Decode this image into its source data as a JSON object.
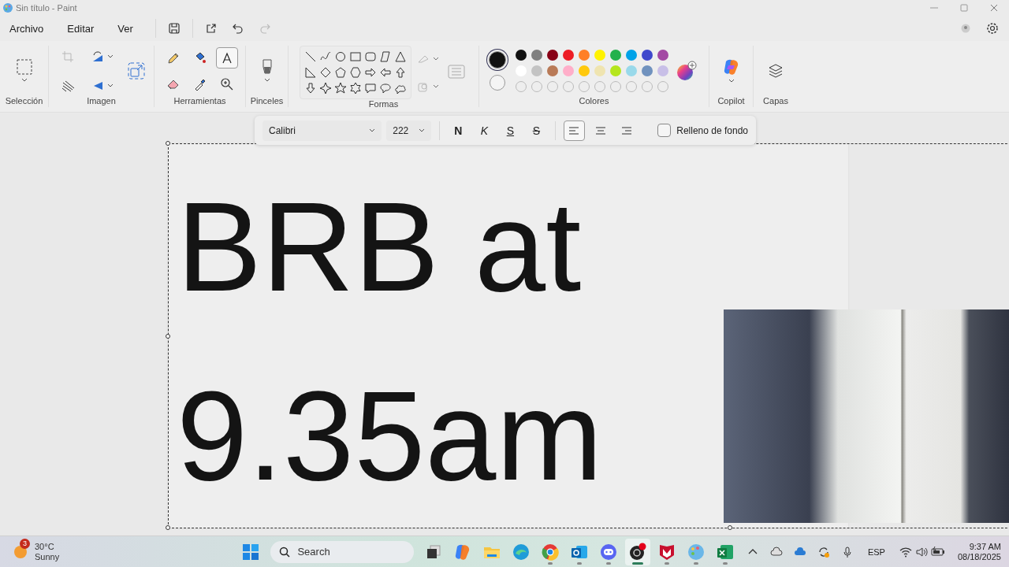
{
  "window": {
    "title": "Sin título - Paint"
  },
  "menu": [
    "Archivo",
    "Editar",
    "Ver"
  ],
  "quick_actions": [
    {
      "kind": "save",
      "disabled": false
    },
    {
      "kind": "share",
      "disabled": false
    },
    {
      "kind": "undo",
      "disabled": false
    },
    {
      "kind": "redo",
      "disabled": true
    }
  ],
  "ribbon": {
    "groups": [
      {
        "label": "Selección",
        "kind": "selection"
      },
      {
        "label": "Imagen",
        "kind": "image"
      },
      {
        "label": "Herramientas",
        "kind": "tools",
        "tools": [
          {
            "kind": "pencil",
            "selected": false
          },
          {
            "kind": "fill",
            "selected": false
          },
          {
            "kind": "text",
            "selected": true
          },
          {
            "kind": "eraser",
            "selected": false
          },
          {
            "kind": "picker",
            "selected": false
          },
          {
            "kind": "zoom",
            "selected": false
          }
        ]
      },
      {
        "label": "Pinceles",
        "kind": "brushes"
      },
      {
        "label": "Formas",
        "kind": "shapes"
      },
      {
        "label": "Colores",
        "kind": "colors",
        "current": [
          {
            "color": "#111111",
            "selected": true
          },
          {
            "color": "#f4f4f4",
            "selected": false
          }
        ],
        "palette": [
          {
            "kind": "swatch",
            "color": "#111111"
          },
          {
            "kind": "swatch",
            "color": "#7f7f7f"
          },
          {
            "kind": "swatch",
            "color": "#880015"
          },
          {
            "kind": "swatch",
            "color": "#ed1c24"
          },
          {
            "kind": "swatch",
            "color": "#ff7f27"
          },
          {
            "kind": "swatch",
            "color": "#fff200"
          },
          {
            "kind": "swatch",
            "color": "#22b14c"
          },
          {
            "kind": "swatch",
            "color": "#00a2e8"
          },
          {
            "kind": "swatch",
            "color": "#3f48cc"
          },
          {
            "kind": "swatch",
            "color": "#a349a4"
          },
          {
            "kind": "swatch",
            "color": "#ffffff"
          },
          {
            "kind": "swatch",
            "color": "#c3c3c3"
          },
          {
            "kind": "swatch",
            "color": "#b97a57"
          },
          {
            "kind": "swatch",
            "color": "#ffaec9"
          },
          {
            "kind": "swatch",
            "color": "#ffc90e"
          },
          {
            "kind": "swatch",
            "color": "#efe4b0"
          },
          {
            "kind": "swatch",
            "color": "#b5e61d"
          },
          {
            "kind": "swatch",
            "color": "#99d9ea"
          },
          {
            "kind": "swatch",
            "color": "#7092be"
          },
          {
            "kind": "swatch",
            "color": "#c8bfe7"
          },
          {
            "kind": "empty"
          },
          {
            "kind": "empty"
          },
          {
            "kind": "empty"
          },
          {
            "kind": "empty"
          },
          {
            "kind": "empty"
          },
          {
            "kind": "empty"
          },
          {
            "kind": "empty"
          },
          {
            "kind": "empty"
          },
          {
            "kind": "empty"
          },
          {
            "kind": "empty"
          }
        ]
      },
      {
        "label": "Copilot",
        "kind": "copilot"
      },
      {
        "label": "Capas",
        "kind": "layers"
      }
    ]
  },
  "text_toolbar": {
    "font": "Calibri",
    "size": "222",
    "styles": [
      {
        "label": "N",
        "kind": "bold",
        "selected": false
      },
      {
        "label": "K",
        "kind": "italic",
        "selected": false
      },
      {
        "label": "S",
        "kind": "underline",
        "selected": false
      },
      {
        "label": "S",
        "kind": "strike",
        "selected": false
      }
    ],
    "alignment": [
      {
        "kind": "left",
        "selected": true
      },
      {
        "kind": "center",
        "selected": false
      },
      {
        "kind": "right",
        "selected": false
      }
    ],
    "background_fill": {
      "label": "Relleno de fondo",
      "checked": false
    }
  },
  "canvas": {
    "text_lines": [
      "BRB at",
      "9.35am"
    ]
  },
  "taskbar": {
    "weather": {
      "badge": "3",
      "temperature": "30°C",
      "condition": "Sunny"
    },
    "search": {
      "placeholder": "Search"
    },
    "apps": [
      {
        "kind": "start",
        "running": false,
        "selected": false
      },
      {
        "kind": "search"
      },
      {
        "kind": "task-view",
        "running": false,
        "selected": false
      },
      {
        "kind": "copilot",
        "running": false,
        "selected": false
      },
      {
        "kind": "folder",
        "running": false,
        "selected": false
      },
      {
        "kind": "edge",
        "running": false,
        "selected": false
      },
      {
        "kind": "chrome",
        "running": true,
        "selected": false
      },
      {
        "kind": "mail",
        "running": true,
        "selected": false
      },
      {
        "kind": "chat",
        "running": true,
        "selected": false
      },
      {
        "kind": "record",
        "running": true,
        "selected": true
      },
      {
        "kind": "shield",
        "running": true,
        "selected": false
      },
      {
        "kind": "paint",
        "running": true,
        "selected": false
      },
      {
        "kind": "sheet",
        "running": true,
        "selected": false
      }
    ],
    "language": "ESP",
    "time": "9:37 AM",
    "date": "08/18/2025"
  }
}
